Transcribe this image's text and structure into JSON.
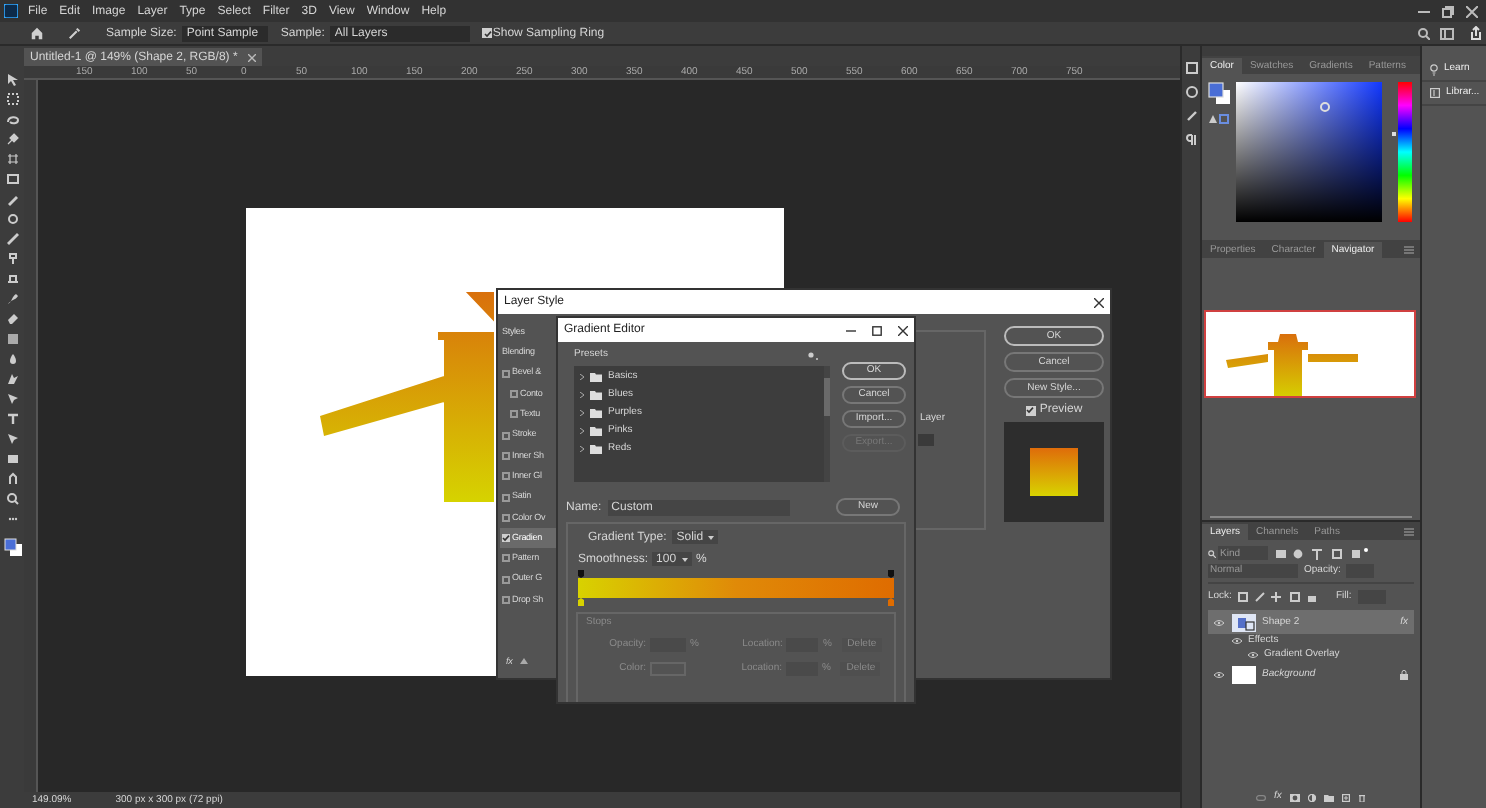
{
  "menu": [
    "File",
    "Edit",
    "Image",
    "Layer",
    "Type",
    "Select",
    "Filter",
    "3D",
    "View",
    "Window",
    "Help"
  ],
  "options_bar": {
    "sample_size_label": "Sample Size:",
    "sample_size": "Point Sample",
    "sample_label": "Sample:",
    "sample": "All Layers",
    "show_sampling_ring": {
      "label": "Show Sampling Ring",
      "checked": true
    }
  },
  "document_tab": {
    "title": "Untitled-1 @ 149% (Shape 2, RGB/8) *"
  },
  "ruler": [
    "150",
    "100",
    "50",
    "0",
    "50",
    "100",
    "150",
    "200",
    "250",
    "300",
    "350",
    "400",
    "450",
    "500",
    "550",
    "600",
    "650",
    "700",
    "750"
  ],
  "layer_style": {
    "title": "Layer Style",
    "styles": [
      {
        "label": "Styles",
        "kind": "header",
        "selected": false
      },
      {
        "label": "Blending",
        "kind": "plain",
        "selected": false
      },
      {
        "label": "Bevel &",
        "kind": "check",
        "checked": false,
        "selected": false
      },
      {
        "label": "Conto",
        "kind": "subcheck",
        "checked": false,
        "selected": false
      },
      {
        "label": "Textu",
        "kind": "subcheck",
        "checked": false,
        "selected": false
      },
      {
        "label": "Stroke",
        "kind": "check",
        "checked": false,
        "selected": false
      },
      {
        "label": "Inner Sh",
        "kind": "check",
        "checked": false,
        "selected": false
      },
      {
        "label": "Inner Gl",
        "kind": "check",
        "checked": false,
        "selected": false
      },
      {
        "label": "Satin",
        "kind": "check",
        "checked": false,
        "selected": false
      },
      {
        "label": "Color Ov",
        "kind": "check",
        "checked": false,
        "selected": false
      },
      {
        "label": "Gradien",
        "kind": "check",
        "checked": true,
        "selected": true
      },
      {
        "label": "Pattern",
        "kind": "check",
        "checked": false,
        "selected": false
      },
      {
        "label": "Outer G",
        "kind": "check",
        "checked": false,
        "selected": false
      },
      {
        "label": "Drop Sh",
        "kind": "check",
        "checked": false,
        "selected": false
      }
    ],
    "footer_fx": "fx",
    "middle_label": "Layer",
    "buttons": [
      "OK",
      "Cancel",
      "New Style..."
    ],
    "preview": {
      "label": "Preview",
      "checked": true
    }
  },
  "gradient_editor": {
    "title": "Gradient Editor",
    "presets_label": "Presets",
    "folders": [
      "Basics",
      "Blues",
      "Purples",
      "Pinks",
      "Reds"
    ],
    "buttons": [
      {
        "label": "OK",
        "disabled": false
      },
      {
        "label": "Cancel",
        "disabled": false
      },
      {
        "label": "Import...",
        "disabled": false
      },
      {
        "label": "Export...",
        "disabled": true
      }
    ],
    "name_label": "Name:",
    "name": "Custom",
    "new_button": "New",
    "type_label": "Gradient Type:",
    "type": "Solid",
    "smoothness_label": "Smoothness:",
    "smoothness": "100",
    "smoothness_unit": "%",
    "stops_label": "Stops",
    "stop_rows": [
      {
        "label": "Opacity:",
        "unit": "%",
        "location_label": "Location:",
        "location_unit": "%",
        "delete": "Delete"
      },
      {
        "label": "Color:",
        "location_label": "Location:",
        "location_unit": "%",
        "delete": "Delete"
      }
    ]
  },
  "color_panel": {
    "tabs": [
      {
        "label": "Color",
        "selected": true
      },
      {
        "label": "Swatches",
        "selected": false
      },
      {
        "label": "Gradients",
        "selected": false
      },
      {
        "label": "Patterns",
        "selected": false
      }
    ]
  },
  "side_buttons": [
    "Learn",
    "Librar..."
  ],
  "navigator_panel": {
    "tabs": [
      {
        "label": "Properties",
        "selected": false
      },
      {
        "label": "Character",
        "selected": false
      },
      {
        "label": "Navigator",
        "selected": true
      }
    ]
  },
  "layers_panel": {
    "tabs": [
      {
        "label": "Layers",
        "selected": true
      },
      {
        "label": "Channels",
        "selected": false
      },
      {
        "label": "Paths",
        "selected": false
      }
    ],
    "filter_placeholder": "Kind",
    "blend_mode": "Normal",
    "opacity_label": "Opacity:",
    "lock_label": "Lock:",
    "fill_label": "Fill:",
    "footer_fx": "fx",
    "layers": [
      {
        "name": "Shape 2",
        "selected": true,
        "visible": true,
        "locked": false,
        "badge": "fx",
        "children": [
          {
            "name": "Effects",
            "visible": true,
            "children": [
              {
                "name": "Gradient Overlay",
                "visible": true
              }
            ]
          }
        ]
      },
      {
        "name": "Background",
        "selected": false,
        "visible": true,
        "locked": true
      }
    ]
  },
  "status_bar": {
    "zoom": "149.09%",
    "document_size": "300 px x 300 px (72 ppi)"
  }
}
